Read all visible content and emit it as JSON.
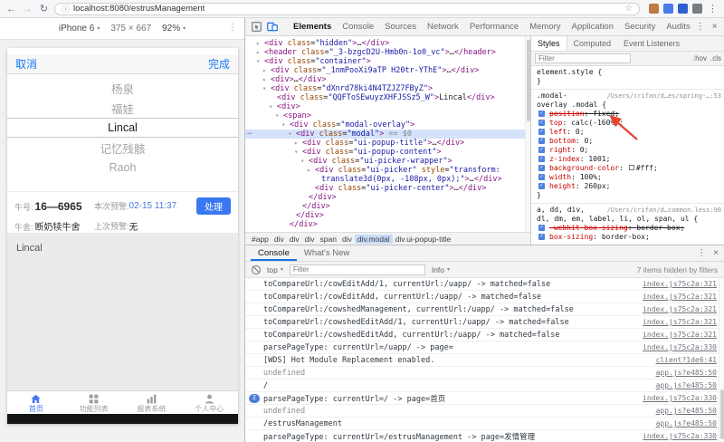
{
  "icons": {
    "back": "←",
    "forward": "→",
    "reload": "↻",
    "info": "ⓘ",
    "star": "☆",
    "more": "⋮",
    "close": "×",
    "caret": "▾",
    "gutter": "⋯"
  },
  "browser": {
    "url": "localhost:8080/estrusManagement",
    "extensions": [
      "extension-1",
      "extension-2",
      "extension-3",
      "extension-4"
    ]
  },
  "device_toolbar": {
    "device": "iPhone 6",
    "dims": "375 × 667",
    "zoom": "92%"
  },
  "phone": {
    "popup": {
      "cancel": "取消",
      "done": "完成"
    },
    "picker_options": [
      {
        "label": "杨泉",
        "selected": false
      },
      {
        "label": "福娃",
        "selected": false
      },
      {
        "label": "Lincal",
        "selected": true
      },
      {
        "label": "记忆残骸",
        "selected": false
      },
      {
        "label": "Raoh",
        "selected": false
      }
    ],
    "card": {
      "cow_label": "牛号:",
      "cow_value": "16—6965",
      "alert_label": "本次预警:",
      "alert_value": "02-15 11:37",
      "handle": "处理",
      "shed_label": "牛舍:",
      "shed_value": "断奶犊牛舍",
      "last_label": "上次预警:",
      "last_value": "无"
    },
    "body_text": "Lincal",
    "tabbar": [
      {
        "label": "首页",
        "icon": "home-icon",
        "active": true
      },
      {
        "label": "功能列表",
        "icon": "grid-icon",
        "active": false
      },
      {
        "label": "报表系统",
        "icon": "report-icon",
        "active": false
      },
      {
        "label": "个人中心",
        "icon": "user-icon",
        "active": false
      }
    ]
  },
  "devtools": {
    "tabs": [
      {
        "label": "Elements",
        "active": true
      },
      {
        "label": "Console",
        "active": false
      },
      {
        "label": "Sources",
        "active": false
      },
      {
        "label": "Network",
        "active": false
      },
      {
        "label": "Performance",
        "active": false
      },
      {
        "label": "Memory",
        "active": false
      },
      {
        "label": "Application",
        "active": false
      },
      {
        "label": "Security",
        "active": false
      },
      {
        "label": "Audits",
        "active": false
      }
    ],
    "tree": [
      {
        "i": 1,
        "a": "c",
        "parts": [
          [
            "p",
            "<div"
          ],
          [
            "a",
            " class"
          ],
          [
            "t",
            "="
          ],
          [
            "v",
            "\"hidden\""
          ],
          [
            "p",
            ">"
          ],
          [
            "t",
            "…"
          ],
          [
            "p",
            "</div>"
          ]
        ]
      },
      {
        "i": 1,
        "a": "c",
        "parts": [
          [
            "p",
            "<header"
          ],
          [
            "a",
            " class"
          ],
          [
            "t",
            "="
          ],
          [
            "v",
            "\"_3-bzgcD2U-Hmb0n-1o0_vc\""
          ],
          [
            "p",
            ">"
          ],
          [
            "t",
            "…"
          ],
          [
            "p",
            "</header>"
          ]
        ]
      },
      {
        "i": 1,
        "a": "o",
        "parts": [
          [
            "p",
            "<div"
          ],
          [
            "a",
            " class"
          ],
          [
            "t",
            "="
          ],
          [
            "v",
            "\"container\""
          ],
          [
            "p",
            ">"
          ]
        ]
      },
      {
        "i": 2,
        "a": "c",
        "parts": [
          [
            "p",
            "<div"
          ],
          [
            "a",
            " class"
          ],
          [
            "t",
            "="
          ],
          [
            "v",
            "\"_1nmPooXi9aTP H20tr-YThE\""
          ],
          [
            "p",
            ">"
          ],
          [
            "t",
            "…"
          ],
          [
            "p",
            "</div>"
          ]
        ]
      },
      {
        "i": 2,
        "a": "c",
        "parts": [
          [
            "p",
            "<div"
          ],
          [
            "p",
            ">"
          ],
          [
            "t",
            "…"
          ],
          [
            "p",
            "</div>"
          ]
        ]
      },
      {
        "i": 2,
        "a": "o",
        "parts": [
          [
            "p",
            "<div"
          ],
          [
            "a",
            " class"
          ],
          [
            "t",
            "="
          ],
          [
            "v",
            "\"dXnrd78ki4N4TZJZ7FByZ\""
          ],
          [
            "p",
            ">"
          ]
        ]
      },
      {
        "i": 3,
        "a": "",
        "parts": [
          [
            "p",
            "<div"
          ],
          [
            "a",
            " class"
          ],
          [
            "t",
            "="
          ],
          [
            "v",
            "\"QQFToSEwuyzXHFJSSz5_W\""
          ],
          [
            "p",
            ">"
          ],
          [
            "t",
            "Lincal"
          ],
          [
            "p",
            "</div>"
          ]
        ]
      },
      {
        "i": 3,
        "a": "o",
        "parts": [
          [
            "p",
            "<div"
          ],
          [
            "p",
            ">"
          ]
        ]
      },
      {
        "i": 4,
        "a": "o",
        "parts": [
          [
            "p",
            "<span"
          ],
          [
            "p",
            ">"
          ]
        ]
      },
      {
        "i": 5,
        "a": "o",
        "parts": [
          [
            "p",
            "<div"
          ],
          [
            "a",
            " class"
          ],
          [
            "t",
            "="
          ],
          [
            "v",
            "\"modal-overlay\""
          ],
          [
            "p",
            ">"
          ]
        ]
      },
      {
        "i": 6,
        "a": "o",
        "sel": true,
        "parts": [
          [
            "p",
            "<div"
          ],
          [
            "a",
            " class"
          ],
          [
            "t",
            "="
          ],
          [
            "v",
            "\"modal\""
          ],
          [
            "p",
            ">"
          ],
          [
            "g",
            " == $0"
          ]
        ]
      },
      {
        "i": 7,
        "a": "c",
        "parts": [
          [
            "p",
            "<div"
          ],
          [
            "a",
            " class"
          ],
          [
            "t",
            "="
          ],
          [
            "v",
            "\"ui-popup-title\""
          ],
          [
            "p",
            ">"
          ],
          [
            "t",
            "…"
          ],
          [
            "p",
            "</div>"
          ]
        ]
      },
      {
        "i": 7,
        "a": "o",
        "parts": [
          [
            "p",
            "<div"
          ],
          [
            "a",
            " class"
          ],
          [
            "t",
            "="
          ],
          [
            "v",
            "\"ui-popup-content\""
          ],
          [
            "p",
            ">"
          ]
        ]
      },
      {
        "i": 8,
        "a": "o",
        "parts": [
          [
            "p",
            "<div"
          ],
          [
            "a",
            " class"
          ],
          [
            "t",
            "="
          ],
          [
            "v",
            "\"ui-picker-wrapper\""
          ],
          [
            "p",
            ">"
          ]
        ]
      },
      {
        "i": 9,
        "a": "c",
        "parts": [
          [
            "p",
            "<div"
          ],
          [
            "a",
            " class"
          ],
          [
            "t",
            "="
          ],
          [
            "v",
            "\"ui-picker\""
          ],
          [
            "a",
            " style"
          ],
          [
            "t",
            "="
          ],
          [
            "v",
            "\"transform:"
          ]
        ]
      },
      {
        "i": 10,
        "a": "",
        "parts": [
          [
            "v",
            "translate3d(0px, -108px, 0px);\""
          ],
          [
            "p",
            ">"
          ],
          [
            "t",
            "…"
          ],
          [
            "p",
            "</div>"
          ]
        ]
      },
      {
        "i": 9,
        "a": "",
        "parts": [
          [
            "p",
            "<div"
          ],
          [
            "a",
            " class"
          ],
          [
            "t",
            "="
          ],
          [
            "v",
            "\"ui-picker-center\""
          ],
          [
            "p",
            ">"
          ],
          [
            "t",
            "…"
          ],
          [
            "p",
            "</div>"
          ]
        ]
      },
      {
        "i": 8,
        "a": "",
        "parts": [
          [
            "p",
            "</div>"
          ]
        ]
      },
      {
        "i": 7,
        "a": "",
        "parts": [
          [
            "p",
            "</div>"
          ]
        ]
      },
      {
        "i": 6,
        "a": "",
        "parts": [
          [
            "p",
            "</div>"
          ]
        ]
      },
      {
        "i": 5,
        "a": "",
        "parts": [
          [
            "p",
            "</div>"
          ]
        ]
      }
    ],
    "breadcrumbs": [
      {
        "label": "#app",
        "selected": false
      },
      {
        "label": "div",
        "selected": false
      },
      {
        "label": "div",
        "selected": false
      },
      {
        "label": "div",
        "selected": false
      },
      {
        "label": "span",
        "selected": false
      },
      {
        "label": "div",
        "selected": false
      },
      {
        "label": "div.modal",
        "selected": true
      },
      {
        "label": "div.ui-popup-title",
        "selected": false
      }
    ],
    "styles_pane": {
      "tabs": [
        {
          "label": "Styles",
          "active": true
        },
        {
          "label": "Computed",
          "active": false
        },
        {
          "label": "Event Listeners",
          "active": false
        }
      ],
      "filter_placeholder": "Filter",
      "toggles": [
        ":hov",
        ".cls"
      ],
      "rules": [
        {
          "sel1": "element.style {",
          "sel2": null,
          "link": null,
          "props": [],
          "close": "}"
        },
        {
          "sel1": ".modal-",
          "sel2": "overlay .modal {",
          "link": "/Users/crifan/d…es/spring-…:53",
          "props": [
            {
              "n": "position",
              "v": "fixed",
              "struck": true
            },
            {
              "n": "top",
              "v": "calc(-160%)"
            },
            {
              "n": "left",
              "v": "0"
            },
            {
              "n": "bottom",
              "v": "0"
            },
            {
              "n": "right",
              "v": "0"
            },
            {
              "n": "z-index",
              "v": "1001"
            },
            {
              "n": "background-color",
              "v": "#fff",
              "swatch": "#ffffff"
            },
            {
              "n": "width",
              "v": "100%"
            },
            {
              "n": "height",
              "v": "260px"
            }
          ],
          "close": "}"
        },
        {
          "sel1": "a, dd, div,",
          "sel2": "dl, dm, em, label, li, ol, span, ul {",
          "link": "/Users/crifan/d…common.less:90",
          "props": [
            {
              "n": "-webkit-box-sizing",
              "v": "border-box",
              "struck": true
            },
            {
              "n": "box-sizing",
              "v": "border-box"
            }
          ],
          "close": null
        }
      ]
    },
    "console": {
      "tabs": [
        {
          "label": "Console",
          "active": true
        },
        {
          "label": "What's New",
          "active": false
        }
      ],
      "context": "top",
      "filter_placeholder": "Filter",
      "level": "Info",
      "hidden_note": "7 items hidden by filters",
      "rows": [
        {
          "m": "toCompareUrl:/cowEditAdd/1, currentUrl:/uapp/ -> matched=false",
          "l": "index.js75c2a:321"
        },
        {
          "m": "toCompareUrl:/cowEditAdd, currentUrl:/uapp/ -> matched=false",
          "l": "index.js75c2a:321"
        },
        {
          "m": "toCompareUrl:/cowshedManagement, currentUrl:/uapp/ -> matched=false",
          "l": "index.js75c2a:321"
        },
        {
          "m": "toCompareUrl:/cowshedEditAdd/1, currentUrl:/uapp/ -> matched=false",
          "l": "index.js75c2a:321"
        },
        {
          "m": "toCompareUrl:/cowshedEditAdd, currentUrl:/uapp/ -> matched=false",
          "l": "index.js75c2a:321"
        },
        {
          "m": "parsePageType: currentUrl=/uapp/ -> page=",
          "l": "index.js75c2a:330"
        },
        {
          "m": "[WDS] Hot Module Replacement enabled.",
          "l": "client?1de6:41"
        },
        {
          "m": "undefined",
          "l": "app.js?e485:50",
          "dim": true
        },
        {
          "m": "/",
          "l": "app.js?e485:50"
        },
        {
          "m": "parsePageType: currentUrl=/ -> page=首页",
          "l": "index.js75c2a:330",
          "badge": "2"
        },
        {
          "m": "undefined",
          "l": "app.js?e485:50",
          "dim": true
        },
        {
          "m": "/estrusManagement",
          "l": "app.js?e485:50"
        },
        {
          "m": "parsePageType: currentUrl=/estrusManagement -> page=发情管理",
          "l": "index.js75c2a:330"
        }
      ]
    }
  }
}
